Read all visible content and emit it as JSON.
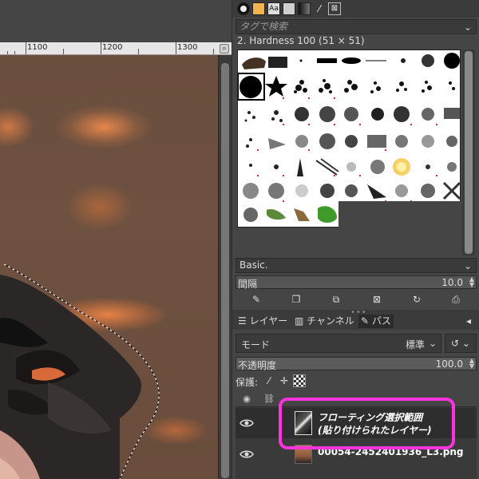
{
  "canvas": {
    "ruler_labels": [
      "1100",
      "1200",
      "1300"
    ]
  },
  "brushes": {
    "tabs": [
      "brush-icon",
      "pattern-icon",
      "font-icon",
      "document-icon",
      "gradient-icon",
      "paint-dynamics-icon",
      "tool-presets-icon"
    ],
    "tag_placeholder": "タグで検索",
    "selected_brush": "2. Hardness 100 (51 × 51)",
    "preset_name": "Basic.",
    "spacing_label": "間隔",
    "spacing_value": "10.0",
    "actions": [
      "edit-brush-icon",
      "new-brush-icon",
      "duplicate-brush-icon",
      "delete-brush-icon",
      "refresh-brushes-icon",
      "open-as-image-icon"
    ]
  },
  "layers": {
    "tabs": {
      "layers": "レイヤー",
      "channels": "チャンネル",
      "paths": "パス"
    },
    "mode_label": "モード",
    "mode_value": "標準",
    "opacity_label": "不透明度",
    "opacity_value": "100.0",
    "opacity_fraction": 1.0,
    "lock_label": "保護:",
    "items": [
      {
        "name_line1": "フローティング選択範囲",
        "name_line2": "(貼り付けられたレイヤー)",
        "visible": true,
        "selected": true
      },
      {
        "name": "00054-2452401936_L3.png",
        "visible": true,
        "selected": false
      }
    ],
    "highlight_color": "#ff33dd"
  }
}
